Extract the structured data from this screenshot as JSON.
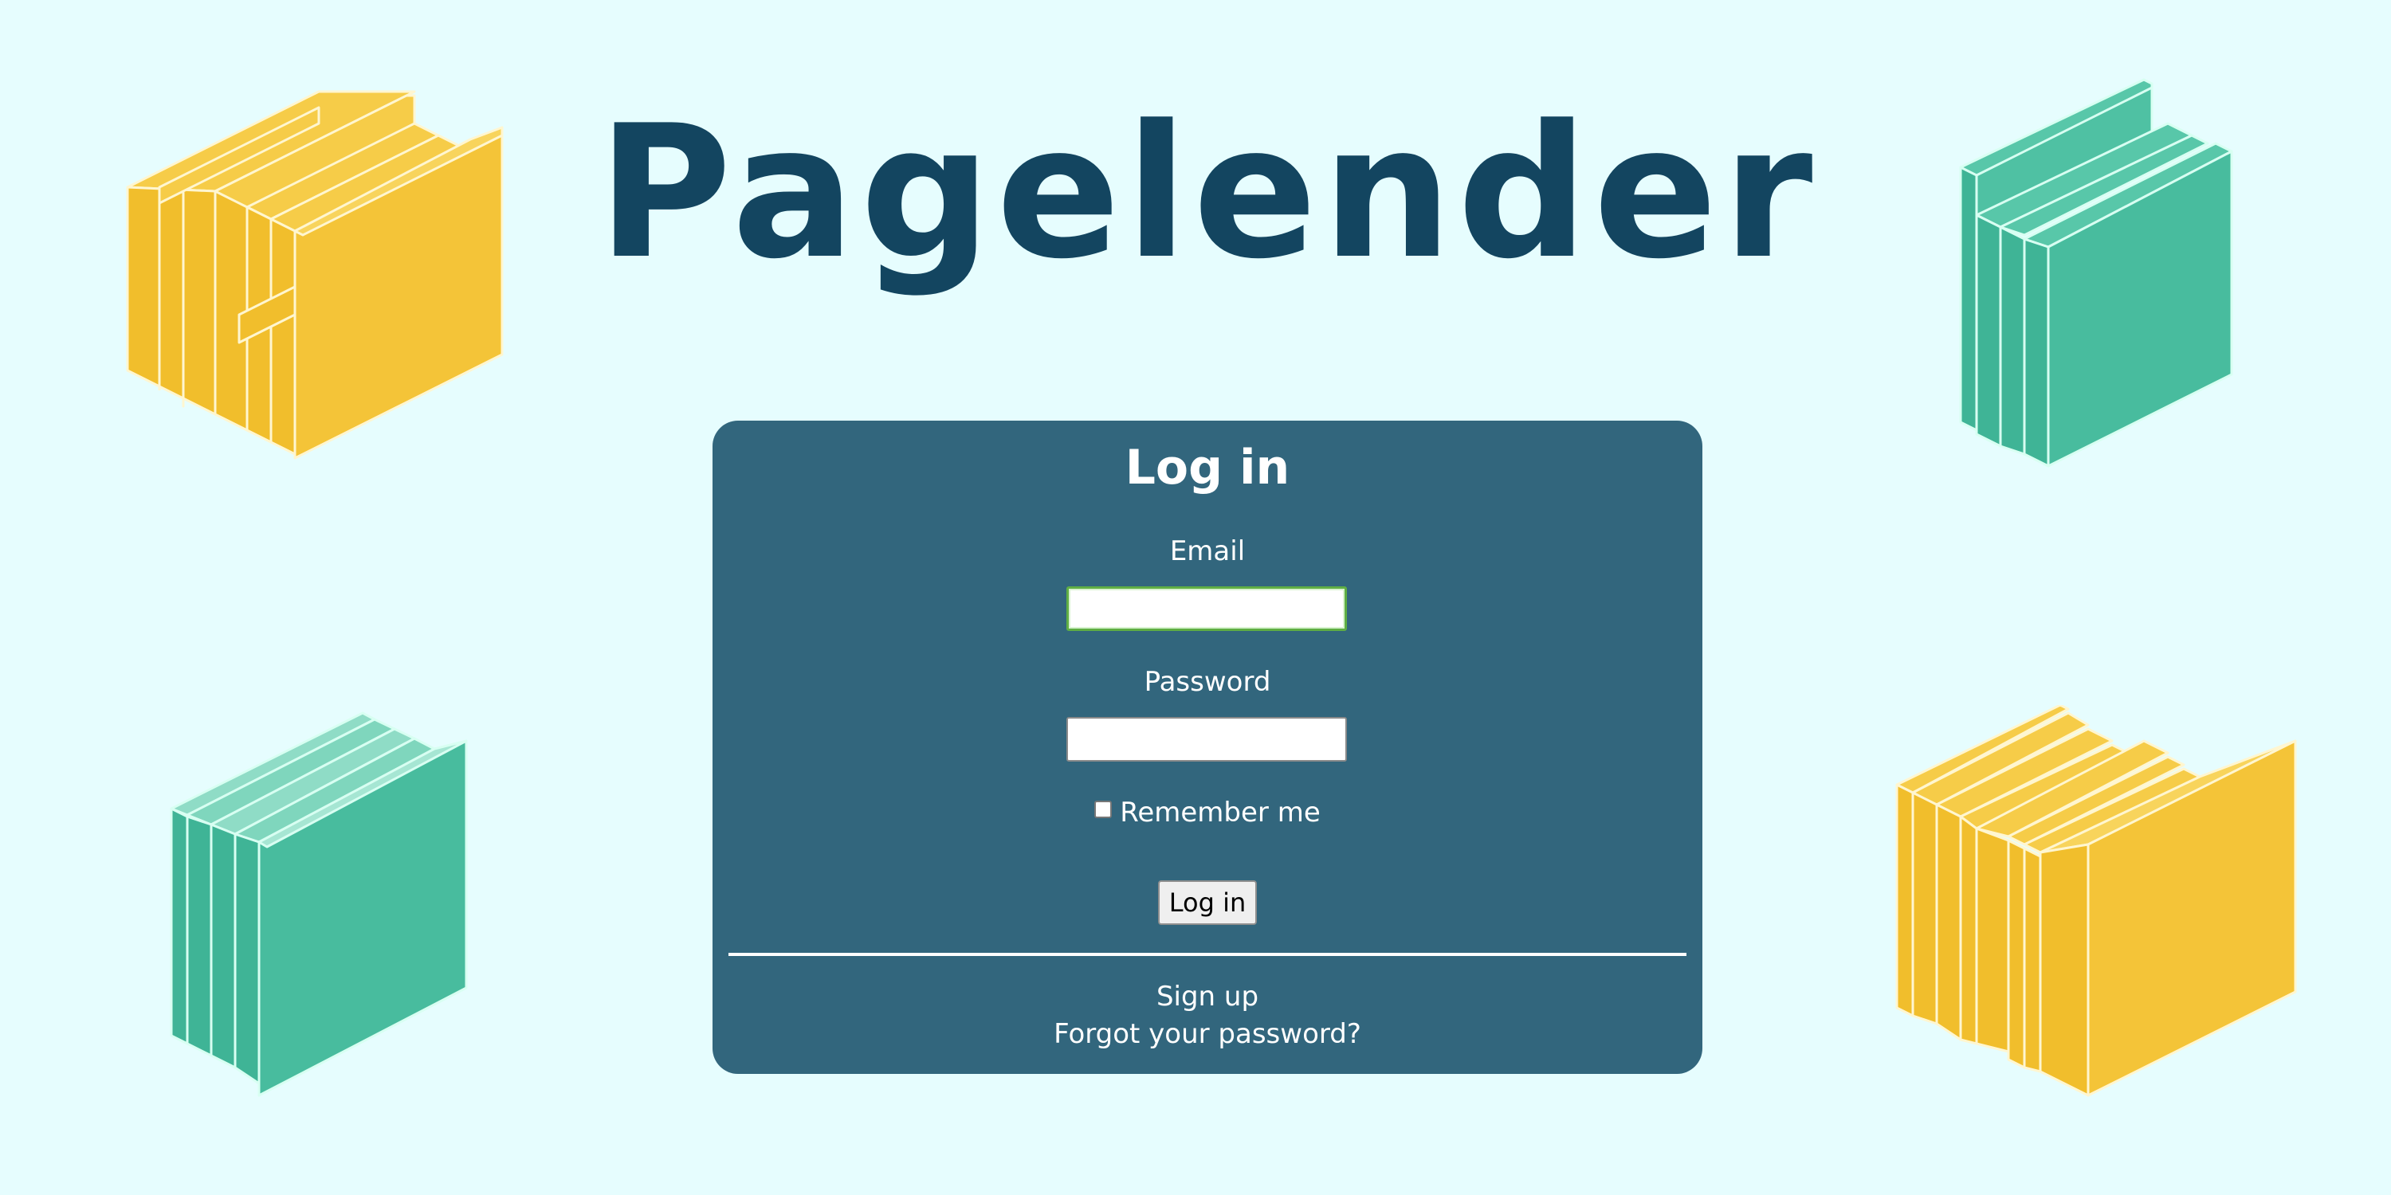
{
  "brand": {
    "title": "Pagelender"
  },
  "login": {
    "heading": "Log in",
    "email_label": "Email",
    "email_value": "",
    "password_label": "Password",
    "password_value": "",
    "remember_label": "Remember me",
    "remember_checked": false,
    "submit_label": "Log in",
    "signup_link": "Sign up",
    "forgot_link": "Forgot your password?"
  },
  "decorations": {
    "top_left": "book-stack-yellow",
    "top_right": "book-stack-teal",
    "bottom_left": "book-stack-teal",
    "bottom_right": "book-stack-yellow"
  },
  "colors": {
    "background": "#e6fdfe",
    "brand_title": "#134560",
    "card": "#32667d",
    "book_yellow": "#f4c438",
    "book_teal": "#48bc9e",
    "focus_border": "#5fae44"
  }
}
